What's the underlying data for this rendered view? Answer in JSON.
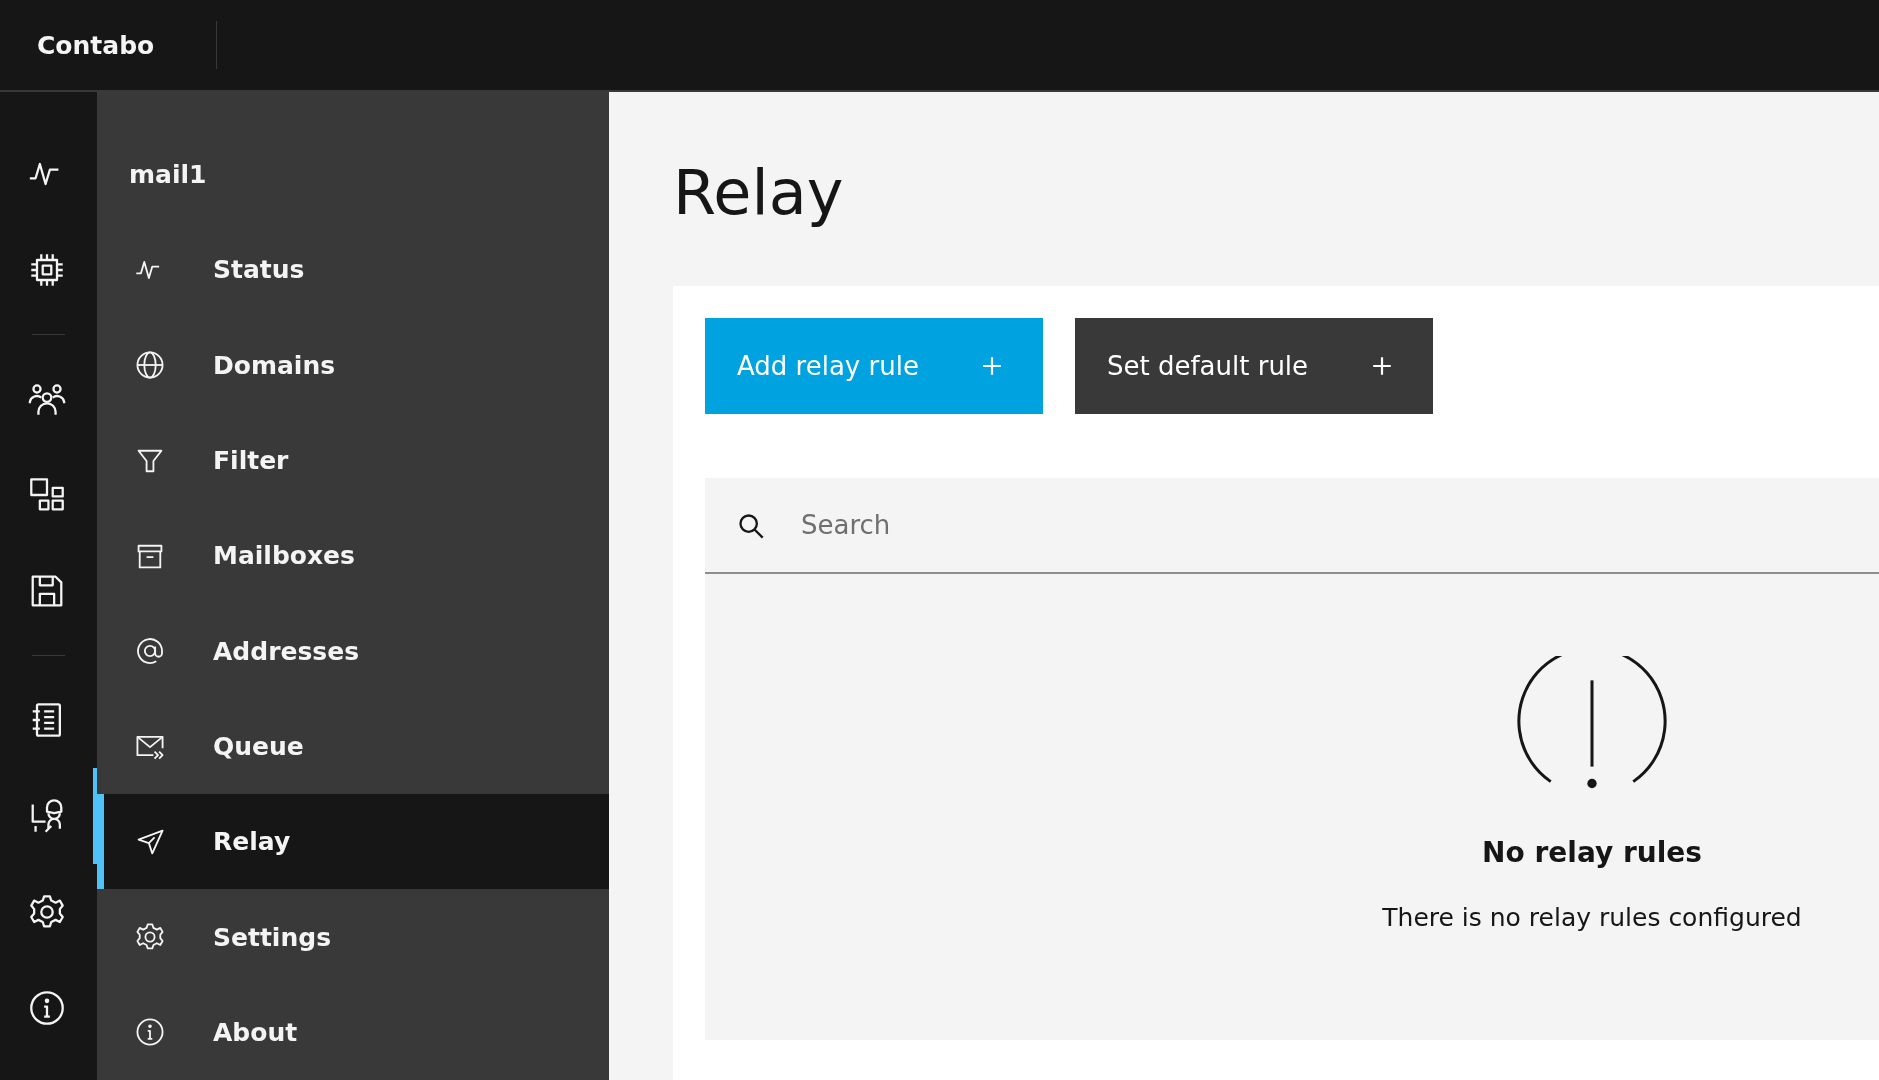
{
  "header": {
    "brand": "Contabo"
  },
  "rail": [
    {
      "kind": "pulse",
      "selected": false
    },
    {
      "kind": "chip",
      "selected": false
    },
    {
      "kind": "divider"
    },
    {
      "kind": "users",
      "selected": false
    },
    {
      "kind": "apps",
      "selected": false
    },
    {
      "kind": "save",
      "selected": false
    },
    {
      "kind": "divider"
    },
    {
      "kind": "notebook",
      "selected": false
    },
    {
      "kind": "agent",
      "selected": true
    },
    {
      "kind": "gear",
      "selected": false
    },
    {
      "kind": "info",
      "selected": false
    }
  ],
  "sidebar": {
    "title": "mail1",
    "items": [
      {
        "label": "Status",
        "kind": "pulse",
        "selected": false
      },
      {
        "label": "Domains",
        "kind": "globe",
        "selected": false
      },
      {
        "label": "Filter",
        "kind": "filter",
        "selected": false
      },
      {
        "label": "Mailboxes",
        "kind": "archive",
        "selected": false
      },
      {
        "label": "Addresses",
        "kind": "at",
        "selected": false
      },
      {
        "label": "Queue",
        "kind": "mailforward",
        "selected": false
      },
      {
        "label": "Relay",
        "kind": "send",
        "selected": true
      },
      {
        "label": "Settings",
        "kind": "gear",
        "selected": false
      },
      {
        "label": "About",
        "kind": "info",
        "selected": false
      }
    ]
  },
  "page": {
    "title": "Relay",
    "buttons": [
      {
        "label": "Add relay rule",
        "kind": "primary"
      },
      {
        "label": "Set default rule",
        "kind": "secondary"
      }
    ],
    "search": {
      "placeholder": "Search"
    },
    "empty": {
      "title": "No relay rules",
      "message": "There is no relay rules configured"
    }
  }
}
